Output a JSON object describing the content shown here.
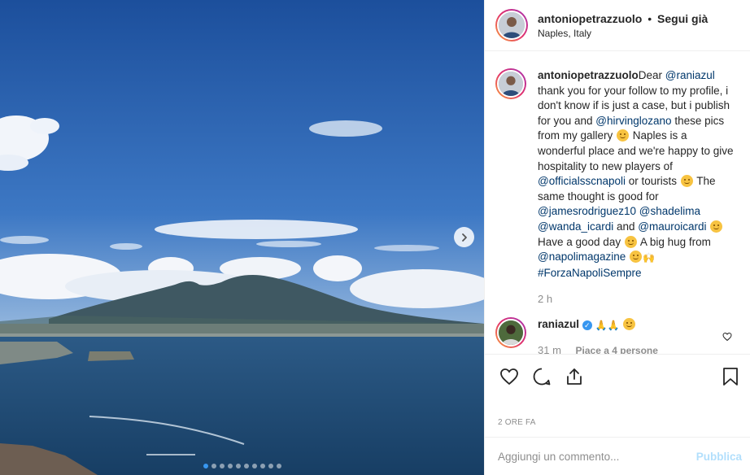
{
  "photo": {
    "carousel_count": 10,
    "carousel_active_index": 0
  },
  "header": {
    "username": "antoniopetrazzuolo",
    "separator": "•",
    "follow_label": "Segui già",
    "location": "Naples, Italy"
  },
  "caption": {
    "username": "antoniopetrazzuolo",
    "p1": "Dear ",
    "m1": "@raniazul",
    "p2": " thank you for your follow to my profile, i don't know if is just a case, but i publish for you and ",
    "m2": "@hirvinglozano",
    "p3": " these pics from my gallery ",
    "p4": " Naples is a wonderful place and we're happy to give hospitality to new players of ",
    "m3": "@officialsscnapoli",
    "p5": " or tourists ",
    "p6": " The same thought is good for ",
    "m4": "@jamesrodriguez10",
    "p7": " ",
    "m5": "@shadelima",
    "p8": " ",
    "m6": "@wanda_icardi",
    "p9": " and ",
    "m7": "@mauroicardi",
    "p10": " Have a good day ",
    "p11": " A big hug from ",
    "m8": "@napolimagazine",
    "p12": " ",
    "m9": "#ForzaNapoliSempre",
    "time": "2 h"
  },
  "reply": {
    "username": "raniazul",
    "verified_mark": "✓",
    "text_emoji": "🙏🙏",
    "time": "31 m",
    "likes": "Piace a 4 persone"
  },
  "actions": {
    "like_icon": "heart-icon",
    "comment_icon": "comment-bubble-icon",
    "share_icon": "share-icon",
    "save_icon": "bookmark-icon"
  },
  "post_date": "2 ORE FA",
  "add_comment": {
    "placeholder": "Aggiungi un commento...",
    "publish_label": "Pubblica",
    "publish_color": "#b2dffc"
  },
  "colors": {
    "mention": "#00376b",
    "accent": "#3897f0",
    "muted": "#8e8e8e"
  }
}
